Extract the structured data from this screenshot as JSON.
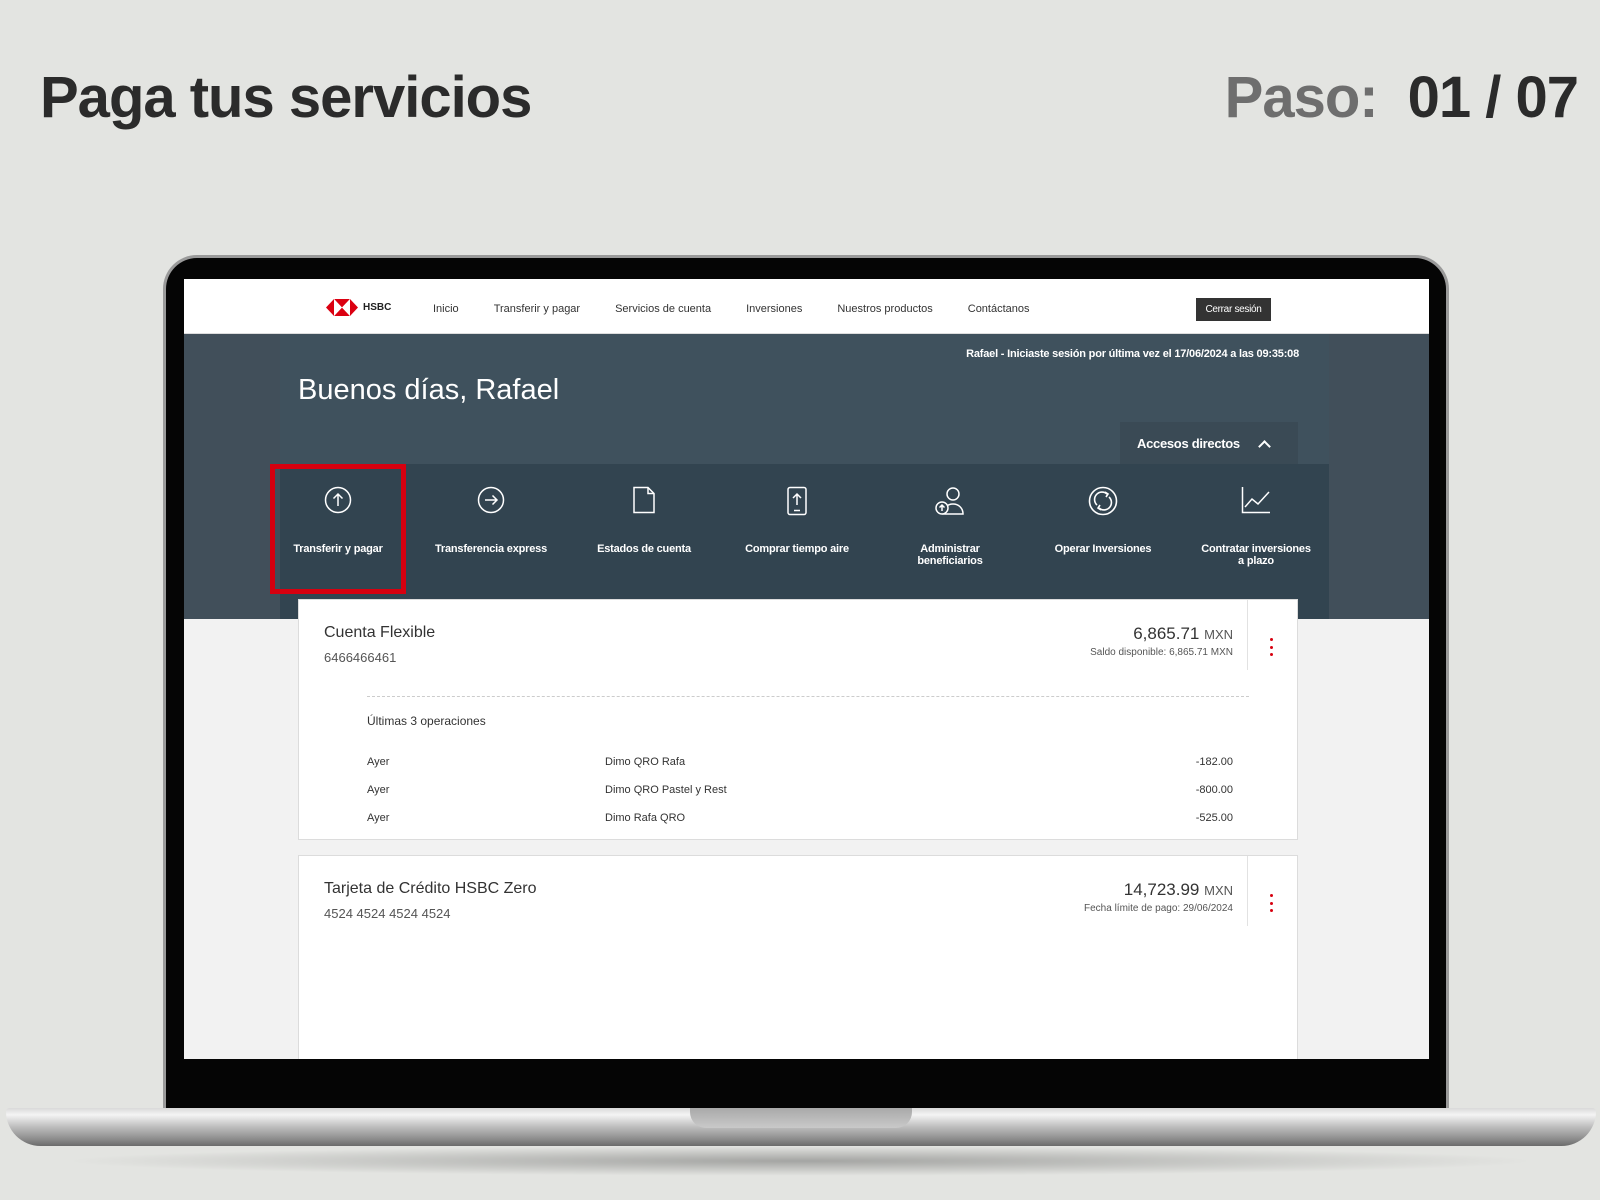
{
  "slide": {
    "title": "Paga tus servicios",
    "step_label": "Paso:",
    "step_value": "01 / 07"
  },
  "nav": {
    "logo_text": "HSBC",
    "items": [
      "Inicio",
      "Transferir y pagar",
      "Servicios de cuenta",
      "Inversiones",
      "Nuestros productos",
      "Contáctanos"
    ],
    "logout": "Cerrar sesión"
  },
  "hero": {
    "last_login": "Rafael - Iniciaste sesión por última vez el 17/06/2024 a las 09:35:08",
    "greeting": "Buenos días, Rafael",
    "access_button": "Accesos directos"
  },
  "shortcuts": [
    {
      "icon": "arrow-up-circle-icon",
      "label": "Transferir y pagar",
      "highlighted": true
    },
    {
      "icon": "arrow-right-circle-icon",
      "label": "Transferencia express"
    },
    {
      "icon": "document-icon",
      "label": "Estados de cuenta"
    },
    {
      "icon": "phone-upload-icon",
      "label": "Comprar tiempo aire"
    },
    {
      "icon": "user-add-icon",
      "label": "Administrar beneficiarios"
    },
    {
      "icon": "refresh-circle-icon",
      "label": "Operar Inversiones"
    },
    {
      "icon": "line-chart-icon",
      "label": "Contratar inversiones a plazo"
    }
  ],
  "highlight_color": "#d7000f",
  "accounts": [
    {
      "name": "Cuenta Flexible",
      "number": "6466466461",
      "balance": "6,865.71",
      "currency": "MXN",
      "sub": "Saldo disponible: 6,865.71 MXN",
      "ops_title": "Últimas 3 operaciones",
      "ops": [
        {
          "date": "Ayer",
          "desc": "Dimo QRO Rafa",
          "amount": "-182.00"
        },
        {
          "date": "Ayer",
          "desc": "Dimo QRO Pastel y Rest",
          "amount": "-800.00"
        },
        {
          "date": "Ayer",
          "desc": "Dimo Rafa QRO",
          "amount": "-525.00"
        }
      ]
    },
    {
      "name": "Tarjeta de Crédito HSBC Zero",
      "number": "4524 4524 4524 4524",
      "balance": "14,723.99",
      "currency": "MXN",
      "sub": "Fecha límite de pago: 29/06/2024"
    }
  ]
}
